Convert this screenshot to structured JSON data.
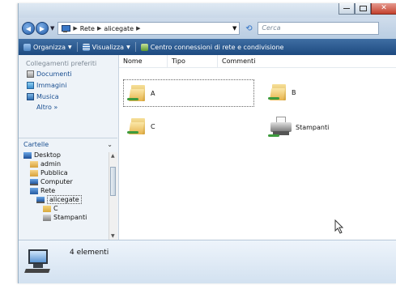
{
  "address": {
    "back_label": "◀",
    "forward_label": "▶",
    "crumbs": [
      "Rete",
      "alicegate"
    ],
    "separator": "▶",
    "search_placeholder": "Cerca"
  },
  "command_bar": {
    "organize": "Organizza",
    "view": "Visualizza",
    "network_center": "Centro connessioni di rete e condivisione"
  },
  "nav_pane": {
    "favorites_header": "Collegamenti preferiti",
    "favorites": [
      {
        "label": "Documenti",
        "icon": "documents-icon"
      },
      {
        "label": "Immagini",
        "icon": "pictures-icon"
      },
      {
        "label": "Musica",
        "icon": "music-icon"
      }
    ],
    "more_label": "Altro »",
    "folders_header": "Cartelle",
    "tree": [
      {
        "label": "Desktop",
        "indent": 1,
        "icon": "desktop-icon"
      },
      {
        "label": "admin",
        "indent": 2,
        "icon": "user-folder-icon"
      },
      {
        "label": "Pubblica",
        "indent": 2,
        "icon": "user-folder-icon"
      },
      {
        "label": "Computer",
        "indent": 2,
        "icon": "computer-icon"
      },
      {
        "label": "Rete",
        "indent": 2,
        "icon": "network-icon"
      },
      {
        "label": "alicegate",
        "indent": 3,
        "icon": "computer-icon",
        "selected": true
      },
      {
        "label": "C",
        "indent": 4,
        "icon": "shared-folder-icon"
      },
      {
        "label": "Stampanti",
        "indent": 4,
        "icon": "printer-icon"
      }
    ]
  },
  "columns": [
    "Nome",
    "Tipo",
    "Commenti"
  ],
  "items": [
    {
      "label": "A",
      "icon": "shared-folder-icon",
      "focused": true
    },
    {
      "label": "B",
      "icon": "shared-folder-icon"
    },
    {
      "label": "C",
      "icon": "shared-folder-icon"
    },
    {
      "label": "Stampanti",
      "icon": "shared-printer-icon"
    }
  ],
  "details": {
    "count_text": "4 elementi"
  }
}
